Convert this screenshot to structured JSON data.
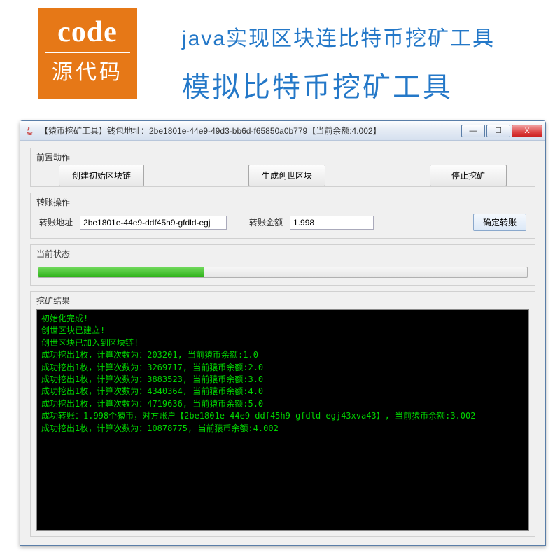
{
  "logo": {
    "main": "code",
    "sub": "源代码"
  },
  "headlines": {
    "line1": "java实现区块连比特币挖矿工具",
    "line2": "模拟比特币挖矿工具"
  },
  "window": {
    "title": "【猿币挖矿工具】钱包地址：2be1801e-44e9-49d3-bb6d-f65850a0b779【当前余额:4.002】",
    "controls": {
      "min": "—",
      "max": "☐",
      "close": "X"
    }
  },
  "presets": {
    "title": "前置动作",
    "btn_create_chain": "创建初始区块链",
    "btn_gen_genesis": "生成创世区块",
    "btn_stop_mining": "停止挖矿"
  },
  "transfer": {
    "title": "转账操作",
    "addr_label": "转账地址",
    "addr_value": "2be1801e-44e9-ddf45h9-gfdld-egj",
    "amount_label": "转账金额",
    "amount_value": "1.998",
    "confirm": "确定转账"
  },
  "status": {
    "title": "当前状态",
    "percent": 34
  },
  "result": {
    "title": "挖矿结果",
    "lines": [
      "初始化完成!",
      "创世区块已建立!",
      "创世区块已加入到区块链!",
      "成功挖出1枚，计算次数为：203201, 当前猿币余额:1.0",
      "成功挖出1枚，计算次数为：3269717, 当前猿币余额:2.0",
      "成功挖出1枚，计算次数为：3883523, 当前猿币余额:3.0",
      "成功挖出1枚，计算次数为：4340364, 当前猿币余额:4.0",
      "成功挖出1枚，计算次数为：4719636, 当前猿币余额:5.0",
      "成功转账：1.998个猿币，对方账户【2be1801e-44e9-ddf45h9-gfdld-egj43xva43】, 当前猿币余额:3.002",
      "成功挖出1枚，计算次数为：10878775, 当前猿币余额:4.002"
    ]
  }
}
